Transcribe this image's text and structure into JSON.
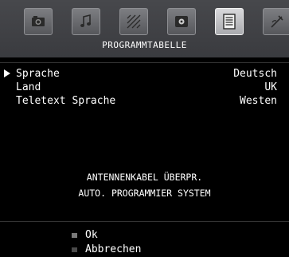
{
  "menu": {
    "title": "PROGRAMMTABELLE",
    "active_tab_index": 4,
    "tabs": [
      {
        "icon": "picture-icon"
      },
      {
        "icon": "sound-icon"
      },
      {
        "icon": "feature-icon"
      },
      {
        "icon": "install-icon"
      },
      {
        "icon": "program-table-icon"
      },
      {
        "icon": "source-icon"
      }
    ]
  },
  "settings": {
    "rows": [
      {
        "label": "Sprache",
        "value": "Deutsch",
        "selected": true
      },
      {
        "label": "Land",
        "value": "UK",
        "selected": false
      },
      {
        "label": "Teletext Sprache",
        "value": "Westen",
        "selected": false
      }
    ]
  },
  "message": {
    "line1": "ANTENNENKABEL ÜBERPR.",
    "line2": "AUTO. PROGRAMMIER SYSTEM"
  },
  "footer": {
    "ok_label": "Ok",
    "cancel_label": "Abbrechen"
  },
  "colors": {
    "ok_dot": "#7a7a7a",
    "cancel_dot": "#4a4a4a"
  }
}
